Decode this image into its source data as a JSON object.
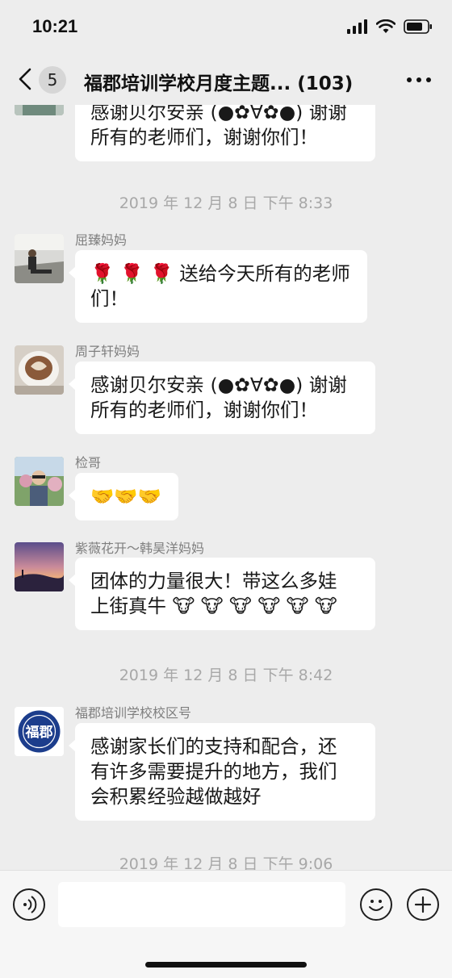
{
  "status": {
    "time": "10:21"
  },
  "nav": {
    "unread_count": "5",
    "title": "福郡培训学校月度主题... (103)"
  },
  "messages": [
    {
      "type": "text",
      "text_lines": [
        "感谢贝尔安亲 (●✿∀✿●) 谢谢",
        "所有的老师们，谢谢你们！"
      ]
    },
    {
      "type": "time",
      "text": "2019 年 12 月 8 日  下午 8:33"
    },
    {
      "type": "text",
      "sender": "屈臻妈妈",
      "text_lines": [
        "🌹 🌹 🌹 送给今天所有的老师",
        "们！"
      ]
    },
    {
      "type": "text",
      "sender": "周子轩妈妈",
      "text_lines": [
        "感谢贝尔安亲 (●✿∀✿●) 谢谢",
        "所有的老师们，谢谢你们！"
      ]
    },
    {
      "type": "text",
      "sender": "检哥",
      "text_lines": [
        "🤝🤝🤝"
      ]
    },
    {
      "type": "text",
      "sender": "紫薇花开～韩昊洋妈妈",
      "text_lines": [
        "团体的力量很大！带这么多娃",
        "上街真牛 🐮 🐮 🐮 🐮 🐮 🐮"
      ]
    },
    {
      "type": "time",
      "text": "2019 年 12 月 8 日  下午 8:42"
    },
    {
      "type": "text",
      "sender": "福郡培训学校校区号",
      "text_lines": [
        "感谢家长们的支持和配合，还",
        "有许多需要提升的地方，我们",
        "会积累经验越做越好"
      ]
    },
    {
      "type": "time",
      "text": "2019 年 12 月 8 日  下午 9:06"
    }
  ],
  "avatars": {
    "school_logo_text": "福郡"
  },
  "input": {
    "value": ""
  }
}
